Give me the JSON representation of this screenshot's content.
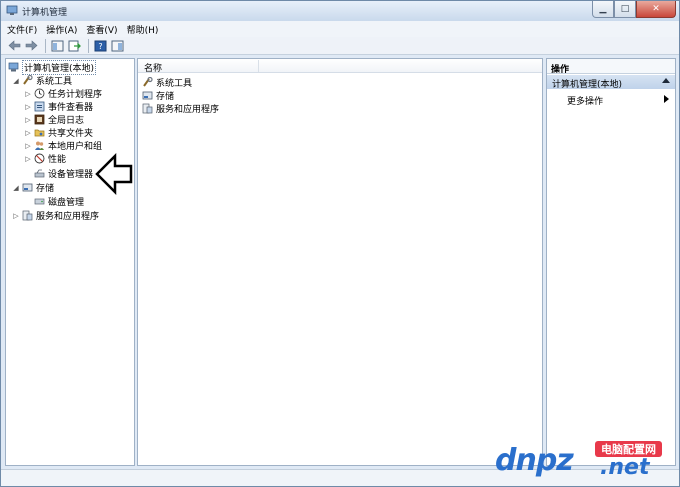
{
  "window": {
    "title": "计算机管理"
  },
  "menu": [
    "文件(F)",
    "操作(A)",
    "查看(V)",
    "帮助(H)"
  ],
  "tree": {
    "root": "计算机管理(本地)",
    "items": [
      {
        "label": "系统工具"
      },
      {
        "label": "任务计划程序"
      },
      {
        "label": "事件查看器"
      },
      {
        "label": "全局日志"
      },
      {
        "label": "共享文件夹"
      },
      {
        "label": "本地用户和组"
      },
      {
        "label": "性能"
      },
      {
        "label": "设备管理器"
      },
      {
        "label": "存储"
      },
      {
        "label": "磁盘管理"
      },
      {
        "label": "服务和应用程序"
      }
    ]
  },
  "list": {
    "column_name": "名称",
    "rows": [
      "系统工具",
      "存储",
      "服务和应用程序"
    ]
  },
  "actions": {
    "header": "操作",
    "section": "计算机管理(本地)",
    "more": "更多操作"
  },
  "watermark": {
    "brand": "dnpz",
    "badge": "电脑配置网",
    "tld": ".net"
  },
  "colors": {
    "window_bg": "#dfe9f5",
    "accent": "#2a6fcc",
    "badge": "#e8394a"
  }
}
